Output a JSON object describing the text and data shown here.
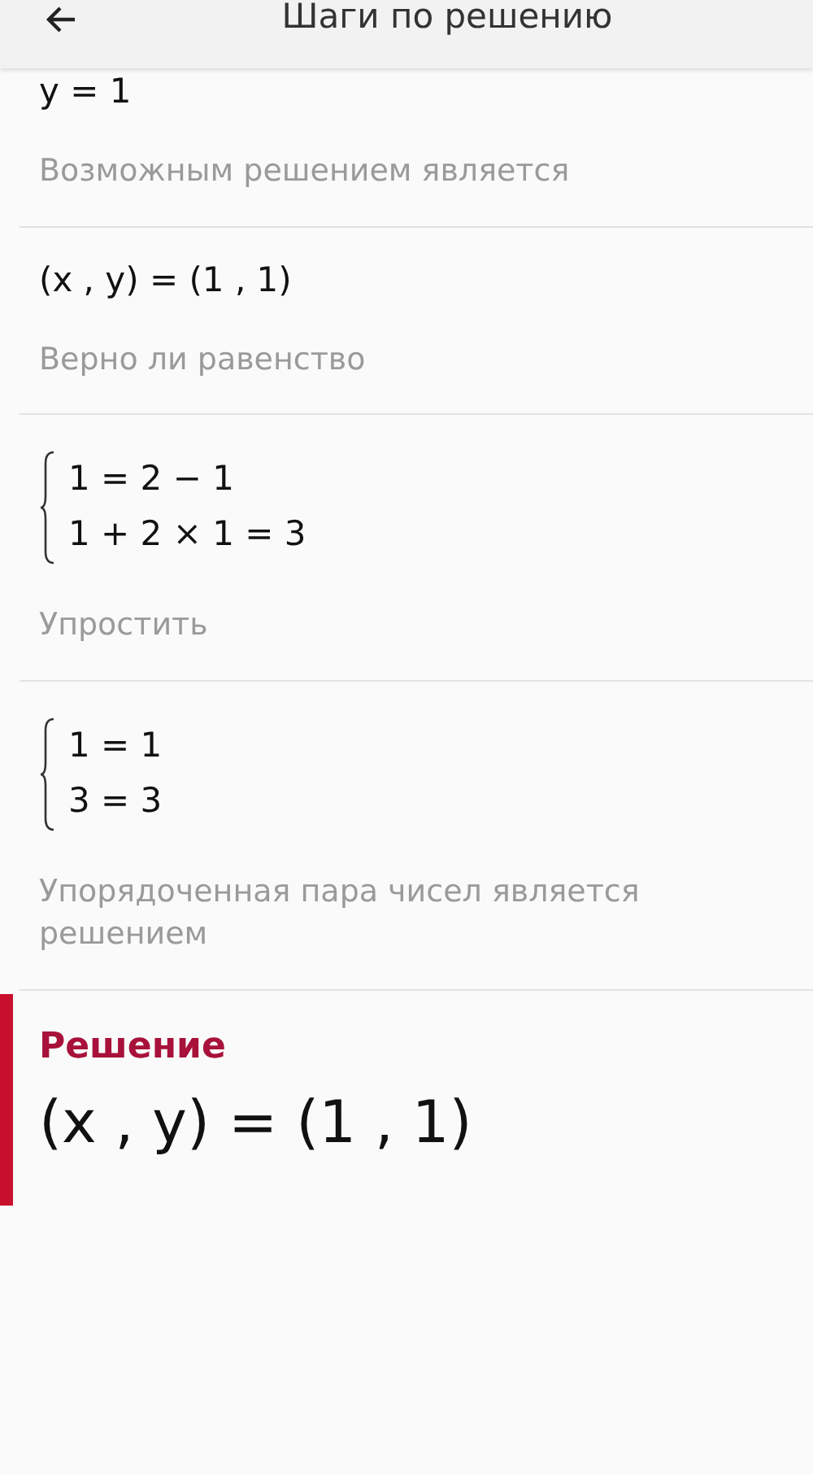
{
  "header": {
    "title": "Шаги по решению"
  },
  "steps": [
    {
      "kind": "expression",
      "lines": [
        "y = 1"
      ],
      "caption": "Возможным решением является"
    },
    {
      "kind": "expression",
      "lines": [
        "(x , y) = (1 , 1)"
      ],
      "caption": "Верно ли равенство"
    },
    {
      "kind": "system",
      "lines": [
        "1 = 2 − 1",
        "1 + 2 × 1 = 3"
      ],
      "caption": "Упростить"
    },
    {
      "kind": "system",
      "lines": [
        "1 = 1",
        "3 = 3"
      ],
      "caption": "Упорядоченная пара чисел является решением"
    }
  ],
  "solution": {
    "title": "Решение",
    "result": "(x , y) = (1 , 1)"
  }
}
